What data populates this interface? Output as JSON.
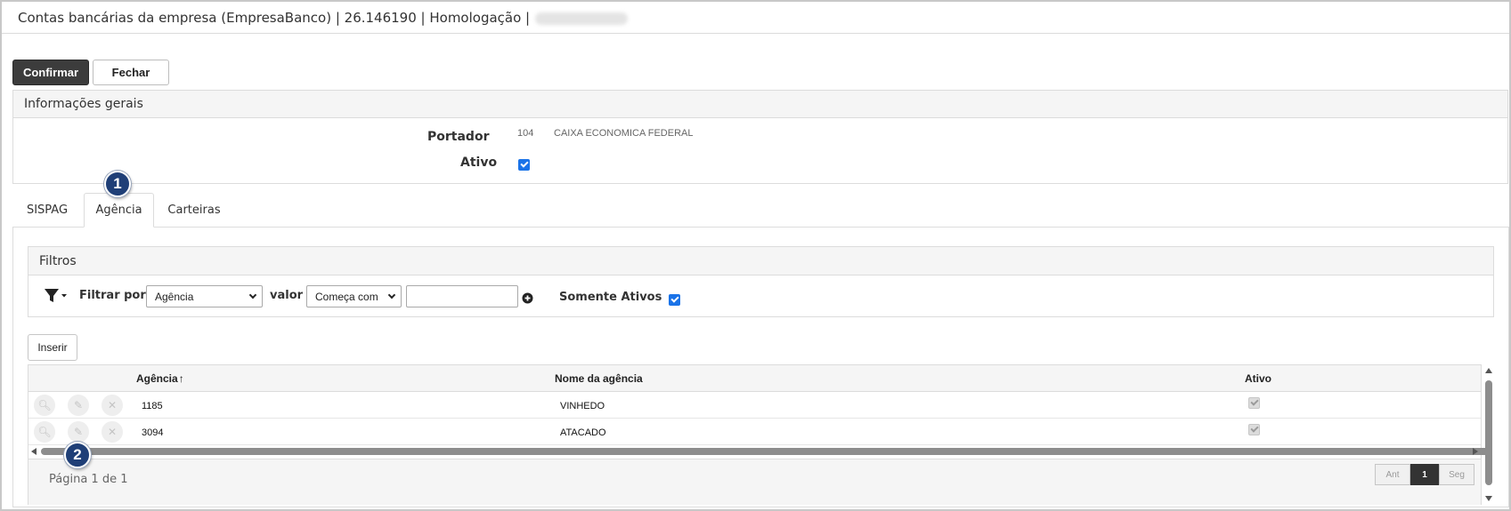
{
  "window": {
    "title": "Contas bancárias da empresa (EmpresaBanco) | 26.146190 | Homologação |"
  },
  "toolbar": {
    "confirm_label": "Confirmar",
    "close_label": "Fechar"
  },
  "general_info": {
    "header": "Informações gerais",
    "portador_label": "Portador",
    "portador_code": "104",
    "portador_name": "CAIXA ECONOMICA FEDERAL",
    "ativo_label": "Ativo",
    "ativo_checked": true
  },
  "tabs": [
    {
      "label": "SISPAG",
      "active": false
    },
    {
      "label": "Agência",
      "active": true
    },
    {
      "label": "Carteiras",
      "active": false
    }
  ],
  "filters": {
    "header": "Filtros",
    "filter_by_label": "Filtrar por",
    "filter_by_value": "Agência",
    "value_label": "valor",
    "operator_value": "Começa com",
    "text_value": "",
    "only_active_label": "Somente Ativos",
    "only_active_checked": true
  },
  "insert_label": "Inserir",
  "grid": {
    "columns": [
      "Agência",
      "Nome da agência",
      "Ativo"
    ],
    "sort_indicator": "↑",
    "rows": [
      {
        "agencia": "1185",
        "nome": "VINHEDO",
        "ativo": true
      },
      {
        "agencia": "3094",
        "nome": "ATACADO",
        "ativo": true
      }
    ],
    "page_info": "Página 1 de 1",
    "pager": {
      "prev": "Ant",
      "current": "1",
      "next": "Seg"
    }
  },
  "annotations": [
    "1",
    "2"
  ],
  "colors": {
    "primary_button": "#3c3c3c",
    "checkbox": "#1a73e8",
    "badge": "#1f3f77"
  },
  "icons": [
    "filter-icon",
    "plus-circle-icon",
    "search-icon",
    "edit-icon",
    "delete-icon",
    "sort-up-icon"
  ]
}
